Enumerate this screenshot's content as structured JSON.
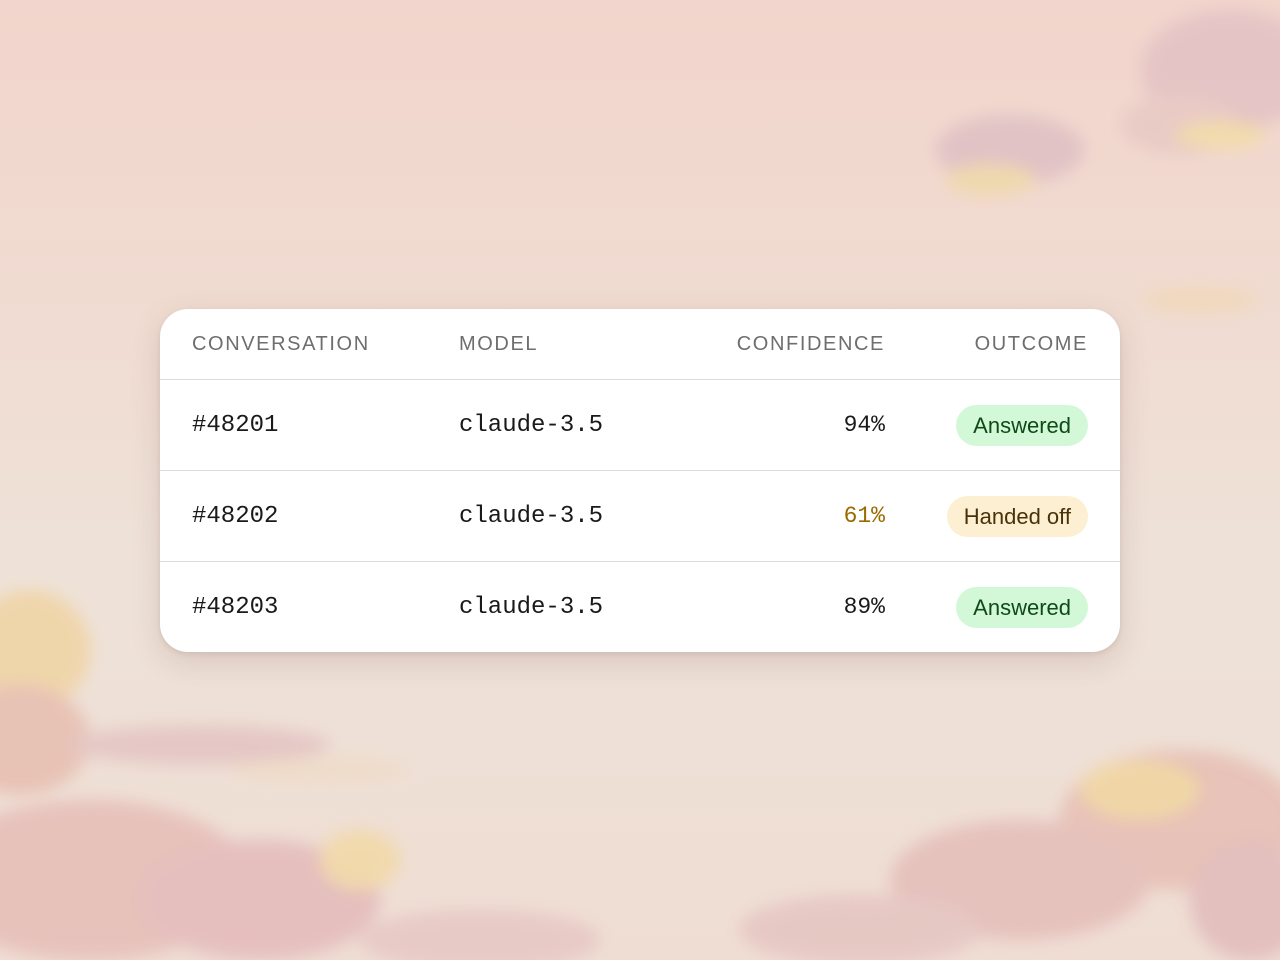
{
  "colors": {
    "answered_bg": "#d3f8d8",
    "answered_text": "#0f4a17",
    "handoff_bg": "#fdefd2",
    "handoff_text": "#4a3208",
    "low_confidence_text": "#9a6a00"
  },
  "table": {
    "headers": {
      "conversation": "CONVERSATION",
      "model": "MODEL",
      "confidence": "CONFIDENCE",
      "outcome": "OUTCOME"
    },
    "rows": [
      {
        "conversation": "#48201",
        "model": "claude-3.5",
        "confidence": "94%",
        "outcome": "Answered",
        "status": "answered"
      },
      {
        "conversation": "#48202",
        "model": "claude-3.5",
        "confidence": "61%",
        "outcome": "Handed off",
        "status": "handed-off"
      },
      {
        "conversation": "#48203",
        "model": "claude-3.5",
        "confidence": "89%",
        "outcome": "Answered",
        "status": "answered"
      }
    ]
  }
}
